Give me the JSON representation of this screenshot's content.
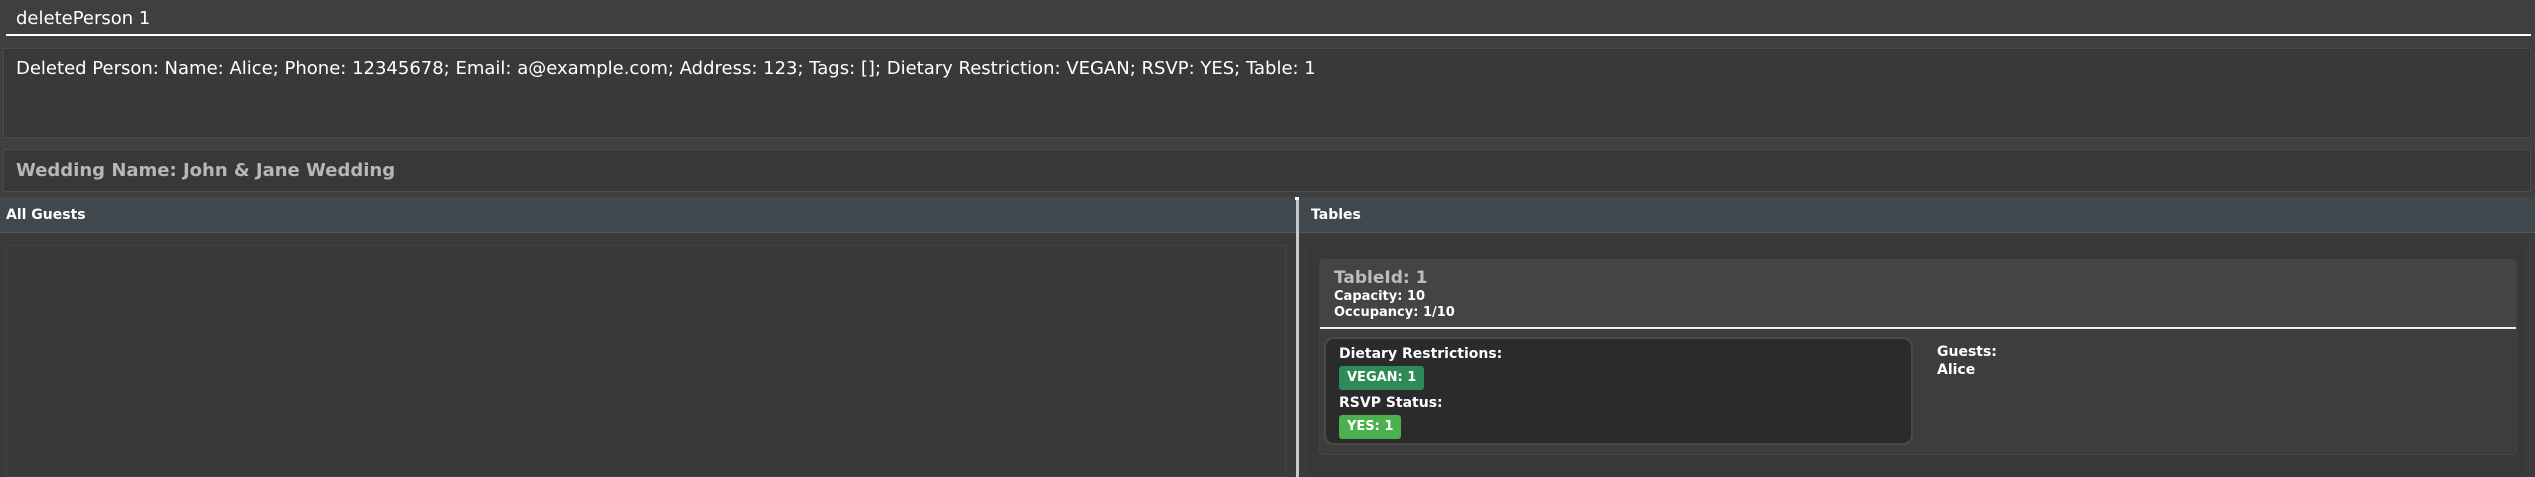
{
  "command": {
    "value": "deletePerson 1"
  },
  "result": {
    "text": "Deleted Person: Name: Alice; Phone: 12345678; Email: a@example.com; Address: 123; Tags: []; Dietary Restriction: VEGAN; RSVP: YES; Table: 1"
  },
  "wedding": {
    "name": "Wedding Name: John & Jane Wedding"
  },
  "guests_panel": {
    "header": "All Guests"
  },
  "tables_panel": {
    "header": "Tables",
    "tables": [
      {
        "id_label": "TableId: 1",
        "capacity_label": "Capacity: 10",
        "occupancy_label": "Occupancy: 1/10",
        "dietary_label": "Dietary Restrictions:",
        "dietary_badge": "VEGAN: 1",
        "rsvp_label": "RSVP Status:",
        "rsvp_badge": "YES: 1",
        "guests_label": "Guests:",
        "guests": [
          "Alice"
        ]
      }
    ]
  },
  "colors": {
    "background": "#3f3f3f",
    "pane_header": "#40484e",
    "vegan_badge": "#2e8b57",
    "yes_badge": "#4caf50"
  }
}
